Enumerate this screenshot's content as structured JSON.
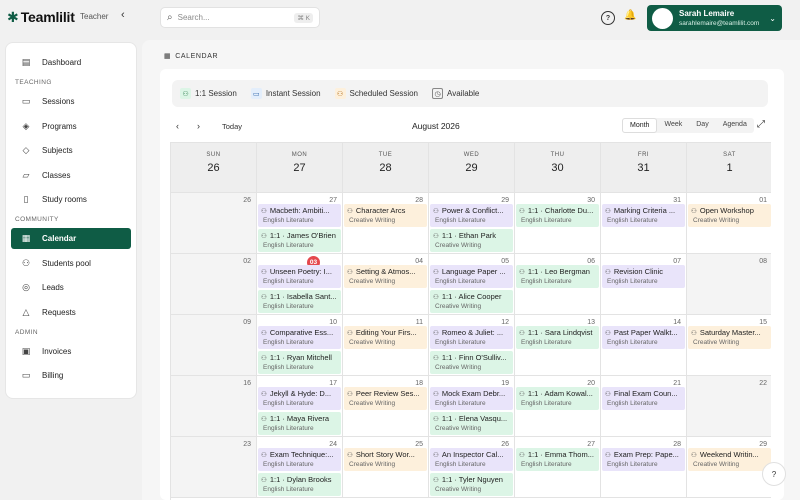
{
  "app": {
    "logo_mark": "✱",
    "name": "Teamlilit",
    "role": "Teacher"
  },
  "search": {
    "placeholder": "Search...",
    "shortcut": "⌘ K"
  },
  "user": {
    "name": "Sarah Lemaire",
    "email": "sarahlemaire@teamlilit.com"
  },
  "sidebar": {
    "dashboard": "Dashboard",
    "teaching_head": "TEACHING",
    "sessions": "Sessions",
    "programs": "Programs",
    "subjects": "Subjects",
    "classes": "Classes",
    "study_rooms": "Study rooms",
    "community_head": "COMMUNITY",
    "calendar": "Calendar",
    "students_pool": "Students pool",
    "leads": "Leads",
    "requests": "Requests",
    "admin_head": "ADMIN",
    "invoices": "Invoices",
    "billing": "Billing"
  },
  "page": {
    "title": "CALENDAR"
  },
  "legend": {
    "one_to_one": "1:1 Session",
    "instant": "Instant Session",
    "scheduled": "Scheduled Session",
    "available": "Available"
  },
  "calendar": {
    "today": "Today",
    "month": "August 2026",
    "views": [
      "Month",
      "Week",
      "Day",
      "Agenda"
    ],
    "day_names": [
      "SUN",
      "MON",
      "TUE",
      "WED",
      "THU",
      "FRI",
      "SAT"
    ],
    "header_dates": [
      "26",
      "27",
      "28",
      "29",
      "30",
      "31",
      "1"
    ],
    "weeks": [
      [
        "26",
        "27",
        "28",
        "29",
        "30",
        "31",
        "01"
      ],
      [
        "02",
        "03",
        "04",
        "05",
        "06",
        "07",
        "08"
      ],
      [
        "09",
        "10",
        "11",
        "12",
        "13",
        "14",
        "15"
      ],
      [
        "16",
        "17",
        "18",
        "19",
        "20",
        "21",
        "22"
      ],
      [
        "23",
        "24",
        "25",
        "26",
        "27",
        "28",
        "29"
      ]
    ],
    "today_cell": "03",
    "events": [
      [
        [],
        [
          {
            "kind": "scheduled-eng",
            "title": "Macbeth: Ambiti...",
            "sub": "English Literature"
          },
          {
            "kind": "one",
            "title": "1:1 · James O'Brien",
            "sub": "English Literature"
          }
        ],
        [
          {
            "kind": "scheduled-cw",
            "title": "Character Arcs",
            "sub": "Creative Writing"
          }
        ],
        [
          {
            "kind": "scheduled-eng",
            "title": "Power & Conflict...",
            "sub": "English Literature"
          },
          {
            "kind": "one",
            "title": "1:1 · Ethan Park",
            "sub": "Creative Writing"
          }
        ],
        [
          {
            "kind": "one",
            "title": "1:1 · Charlotte Du...",
            "sub": "English Literature"
          }
        ],
        [
          {
            "kind": "scheduled-eng",
            "title": "Marking Criteria ...",
            "sub": "English Literature"
          }
        ],
        [
          {
            "kind": "scheduled-cw",
            "title": "Open Workshop",
            "sub": "Creative Writing"
          }
        ]
      ],
      [
        [],
        [
          {
            "kind": "scheduled-eng",
            "title": "Unseen Poetry: I...",
            "sub": "English Literature"
          },
          {
            "kind": "one",
            "title": "1:1 · Isabella Sant...",
            "sub": "English Literature"
          }
        ],
        [
          {
            "kind": "scheduled-cw",
            "title": "Setting & Atmos...",
            "sub": "Creative Writing"
          }
        ],
        [
          {
            "kind": "scheduled-eng",
            "title": "Language Paper ...",
            "sub": "English Literature"
          },
          {
            "kind": "one",
            "title": "1:1 · Alice Cooper",
            "sub": "Creative Writing"
          }
        ],
        [
          {
            "kind": "one",
            "title": "1:1 · Leo Bergman",
            "sub": "English Literature"
          }
        ],
        [
          {
            "kind": "scheduled-eng",
            "title": "Revision Clinic",
            "sub": "English Literature"
          }
        ],
        []
      ],
      [
        [],
        [
          {
            "kind": "scheduled-eng",
            "title": "Comparative Ess...",
            "sub": "English Literature"
          },
          {
            "kind": "one",
            "title": "1:1 · Ryan Mitchell",
            "sub": "English Literature"
          }
        ],
        [
          {
            "kind": "scheduled-cw",
            "title": "Editing Your Firs...",
            "sub": "Creative Writing"
          }
        ],
        [
          {
            "kind": "scheduled-eng",
            "title": "Romeo & Juliet: ...",
            "sub": "English Literature"
          },
          {
            "kind": "one",
            "title": "1:1 · Finn O'Sulliv...",
            "sub": "Creative Writing"
          }
        ],
        [
          {
            "kind": "one",
            "title": "1:1 · Sara Lindqvist",
            "sub": "English Literature"
          }
        ],
        [
          {
            "kind": "scheduled-eng",
            "title": "Past Paper Walkt...",
            "sub": "English Literature"
          }
        ],
        [
          {
            "kind": "scheduled-cw",
            "title": "Saturday Master...",
            "sub": "Creative Writing"
          }
        ]
      ],
      [
        [],
        [
          {
            "kind": "scheduled-eng",
            "title": "Jekyll & Hyde: D...",
            "sub": "English Literature"
          },
          {
            "kind": "one",
            "title": "1:1 · Maya Rivera",
            "sub": "English Literature"
          }
        ],
        [
          {
            "kind": "scheduled-cw",
            "title": "Peer Review Ses...",
            "sub": "Creative Writing"
          }
        ],
        [
          {
            "kind": "scheduled-eng",
            "title": "Mock Exam Debr...",
            "sub": "English Literature"
          },
          {
            "kind": "one",
            "title": "1:1 · Elena Vasqu...",
            "sub": "Creative Writing"
          }
        ],
        [
          {
            "kind": "one",
            "title": "1:1 · Adam Kowal...",
            "sub": "English Literature"
          }
        ],
        [
          {
            "kind": "scheduled-eng",
            "title": "Final Exam Coun...",
            "sub": "English Literature"
          }
        ],
        []
      ],
      [
        [],
        [
          {
            "kind": "scheduled-eng",
            "title": "Exam Technique:...",
            "sub": "English Literature"
          },
          {
            "kind": "one",
            "title": "1:1 · Dylan Brooks",
            "sub": "English Literature"
          }
        ],
        [
          {
            "kind": "scheduled-cw",
            "title": "Short Story Wor...",
            "sub": "Creative Writing"
          }
        ],
        [
          {
            "kind": "scheduled-eng",
            "title": "An Inspector Cal...",
            "sub": "English Literature"
          },
          {
            "kind": "one",
            "title": "1:1 · Tyler Nguyen",
            "sub": "Creative Writing"
          }
        ],
        [
          {
            "kind": "one",
            "title": "1:1 · Emma Thom...",
            "sub": "English Literature"
          }
        ],
        [
          {
            "kind": "scheduled-eng",
            "title": "Exam Prep: Pape...",
            "sub": "English Literature"
          }
        ],
        [
          {
            "kind": "scheduled-cw",
            "title": "Weekend Writin...",
            "sub": "Creative Writing"
          }
        ]
      ]
    ]
  },
  "icons": {
    "search": "search-icon",
    "collapse": "chevron-left-icon",
    "help": "help-circle-icon",
    "bell": "bell-icon",
    "calendar": "calendar-icon"
  },
  "colors": {
    "brand": "#0f5c45",
    "today_badge": "#e5484d"
  },
  "help_label": "?"
}
